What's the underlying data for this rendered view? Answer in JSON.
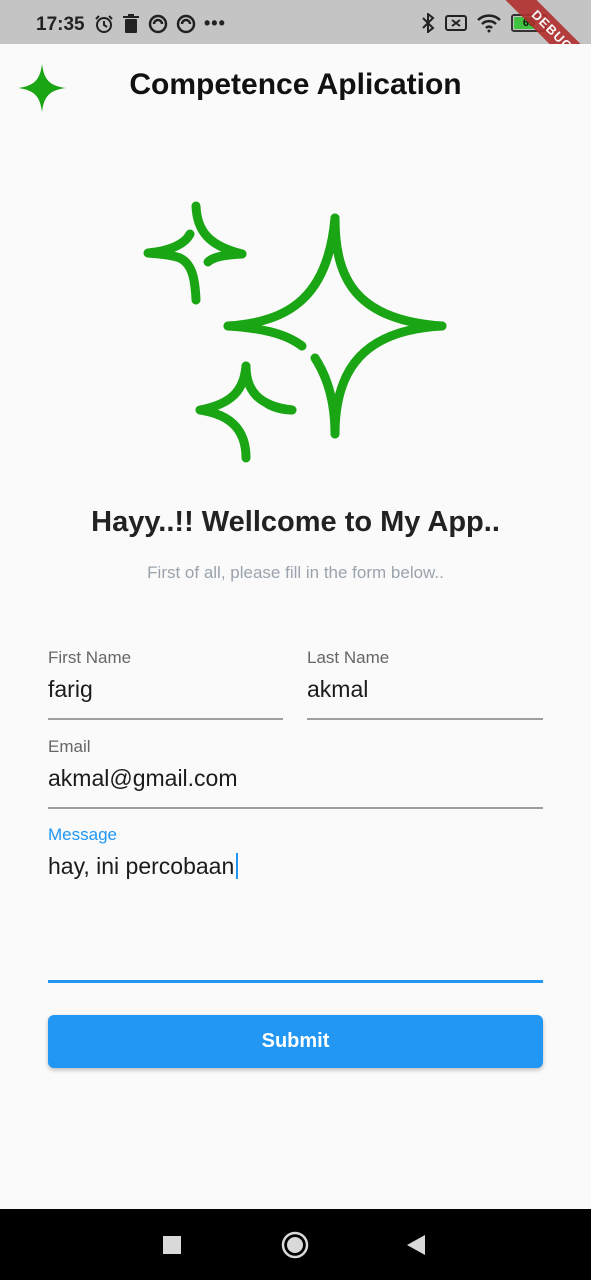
{
  "status_bar": {
    "time": "17:35",
    "battery_level": "65",
    "left_icons": [
      "alarm-icon",
      "trash-icon",
      "sync-icon",
      "sync-icon"
    ],
    "right_icons": [
      "bluetooth-icon",
      "sim-off-icon",
      "wifi-icon",
      "battery-icon"
    ],
    "debug_label": "DEBUG"
  },
  "app_bar": {
    "title": "Competence Aplication",
    "logo_icon": "sparkle-icon"
  },
  "hero": {
    "icon": "sparkles-icon",
    "color": "#1aa514"
  },
  "welcome": {
    "title": "Hayy..!! Wellcome to My App..",
    "subtitle": "First of all, please fill in the form below.."
  },
  "form": {
    "first_name": {
      "label": "First Name",
      "value": "farig"
    },
    "last_name": {
      "label": "Last Name",
      "value": "akmal"
    },
    "email": {
      "label": "Email",
      "value": "akmal@gmail.com"
    },
    "message": {
      "label": "Message",
      "value": "hay, ini percobaan"
    },
    "submit_label": "Submit",
    "accent": "#2196f3"
  },
  "nav_bar": {
    "buttons": [
      "recent-apps-icon",
      "home-icon",
      "back-icon"
    ]
  }
}
